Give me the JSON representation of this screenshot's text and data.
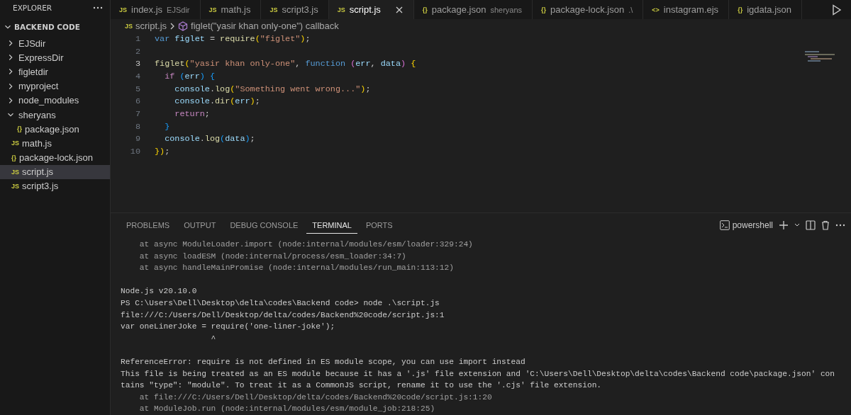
{
  "sidebar": {
    "title": "EXPLORER",
    "root": {
      "label": "BACKEND CODE",
      "expanded": true,
      "children": [
        {
          "kind": "folder",
          "label": "EJSdir",
          "expanded": false,
          "selected": false
        },
        {
          "kind": "folder",
          "label": "ExpressDir",
          "expanded": false,
          "selected": false
        },
        {
          "kind": "folder",
          "label": "figletdir",
          "expanded": false,
          "selected": false
        },
        {
          "kind": "folder",
          "label": "myproject",
          "expanded": false,
          "selected": false
        },
        {
          "kind": "folder",
          "label": "node_modules",
          "expanded": false,
          "selected": false
        },
        {
          "kind": "folder",
          "label": "sheryans",
          "expanded": true,
          "selected": false,
          "children": [
            {
              "kind": "file",
              "badge": "{}",
              "label": "package.json",
              "selected": false
            }
          ]
        },
        {
          "kind": "file",
          "badge": "JS",
          "label": "math.js",
          "selected": false
        },
        {
          "kind": "file",
          "badge": "{}",
          "label": "package-lock.json",
          "selected": false
        },
        {
          "kind": "file",
          "badge": "JS",
          "label": "script.js",
          "selected": true
        },
        {
          "kind": "file",
          "badge": "JS",
          "label": "script3.js",
          "selected": false
        }
      ]
    }
  },
  "tabs": [
    {
      "badge": "JS",
      "label": "index.js",
      "detail": "EJSdir",
      "selected": false
    },
    {
      "badge": "JS",
      "label": "math.js",
      "selected": false
    },
    {
      "badge": "JS",
      "label": "script3.js",
      "selected": false
    },
    {
      "badge": "JS",
      "label": "script.js",
      "selected": true
    },
    {
      "badge": "{}",
      "label": "package.json",
      "detail": "sheryans",
      "selected": false
    },
    {
      "badge": "{}",
      "label": "package-lock.json",
      "detail": ".\\",
      "selected": false
    },
    {
      "badge": "<>",
      "label": "instagram.ejs",
      "selected": false
    },
    {
      "badge": "{}",
      "label": "igdata.json",
      "selected": false
    }
  ],
  "breadcrumb": {
    "badge": "JS",
    "file": "script.js",
    "symbol": "figlet(\"yasir khan only-one\") callback"
  },
  "editor": {
    "lines": [
      {
        "number": "1",
        "tokens": [
          {
            "kind": "kw",
            "text": "var"
          },
          {
            "kind": "var",
            "text": " figlet"
          },
          {
            "kind": "plain",
            "text": " = "
          },
          {
            "kind": "fn",
            "text": "require"
          },
          {
            "kind": "b1",
            "text": "("
          },
          {
            "kind": "str",
            "text": "\"figlet\""
          },
          {
            "kind": "b1",
            "text": ")"
          },
          {
            "kind": "plain",
            "text": ";"
          }
        ]
      },
      {
        "number": "2"
      },
      {
        "number": "3",
        "tokens": [
          {
            "kind": "fn",
            "text": "figlet"
          },
          {
            "kind": "b1",
            "text": "("
          },
          {
            "kind": "str",
            "text": "\"yasir khan only-one\""
          },
          {
            "kind": "plain",
            "text": ", "
          },
          {
            "kind": "kw",
            "text": "function"
          },
          {
            "kind": "b2",
            "text": " ("
          },
          {
            "kind": "var",
            "text": "err"
          },
          {
            "kind": "plain",
            "text": ", "
          },
          {
            "kind": "var",
            "text": "data"
          },
          {
            "kind": "b2",
            "text": ")"
          },
          {
            "kind": "b1",
            "text": " {"
          }
        ]
      },
      {
        "number": "4",
        "tokens": [
          {
            "kind": "ctl",
            "text": "  if"
          },
          {
            "kind": "b3",
            "text": " ("
          },
          {
            "kind": "var",
            "text": "err"
          },
          {
            "kind": "b3",
            "text": ")"
          },
          {
            "kind": "b3",
            "text": " {"
          }
        ]
      },
      {
        "number": "5",
        "tokens": [
          {
            "kind": "var",
            "text": "    console"
          },
          {
            "kind": "plain",
            "text": "."
          },
          {
            "kind": "fn",
            "text": "log"
          },
          {
            "kind": "b1",
            "text": "("
          },
          {
            "kind": "str",
            "text": "\"Something went wrong...\""
          },
          {
            "kind": "b1",
            "text": ")"
          },
          {
            "kind": "plain",
            "text": ";"
          }
        ]
      },
      {
        "number": "6",
        "tokens": [
          {
            "kind": "var",
            "text": "    console"
          },
          {
            "kind": "plain",
            "text": "."
          },
          {
            "kind": "fn",
            "text": "dir"
          },
          {
            "kind": "b1",
            "text": "("
          },
          {
            "kind": "var",
            "text": "err"
          },
          {
            "kind": "b1",
            "text": ")"
          },
          {
            "kind": "plain",
            "text": ";"
          }
        ]
      },
      {
        "number": "7",
        "tokens": [
          {
            "kind": "ctl",
            "text": "    return"
          },
          {
            "kind": "plain",
            "text": ";"
          }
        ]
      },
      {
        "number": "8",
        "tokens": [
          {
            "kind": "b3",
            "text": "  }"
          }
        ]
      },
      {
        "number": "9",
        "tokens": [
          {
            "kind": "var",
            "text": "  console"
          },
          {
            "kind": "plain",
            "text": "."
          },
          {
            "kind": "fn",
            "text": "log"
          },
          {
            "kind": "b3",
            "text": "("
          },
          {
            "kind": "var",
            "text": "data"
          },
          {
            "kind": "b3",
            "text": ")"
          },
          {
            "kind": "plain",
            "text": ";"
          }
        ]
      },
      {
        "number": "10",
        "tokens": [
          {
            "kind": "b1",
            "text": "}"
          },
          {
            "kind": "b1",
            "text": ")"
          },
          {
            "kind": "plain",
            "text": ";"
          }
        ]
      }
    ]
  },
  "panel": {
    "tabs": [
      {
        "label": "PROBLEMS",
        "selected": false
      },
      {
        "label": "OUTPUT",
        "selected": false
      },
      {
        "label": "DEBUG CONSOLE",
        "selected": false
      },
      {
        "label": "TERMINAL",
        "selected": true
      },
      {
        "label": "PORTS",
        "selected": false
      }
    ],
    "shell": "powershell",
    "lines": [
      {
        "kind": "stack",
        "text": "    at async ModuleLoader.import (node:internal/modules/esm/loader:329:24)"
      },
      {
        "kind": "stack",
        "text": "    at async loadESM (node:internal/process/esm_loader:34:7)"
      },
      {
        "kind": "stack",
        "text": "    at async handleMainPromise (node:internal/modules/run_main:113:12)"
      },
      {
        "kind": "blank"
      },
      {
        "kind": "normal",
        "text": "Node.js v20.10.0"
      },
      {
        "kind": "normal",
        "text": "PS C:\\Users\\Dell\\Desktop\\delta\\codes\\Backend code> node .\\script.js"
      },
      {
        "kind": "normal",
        "text": "file:///C:/Users/Dell/Desktop/delta/codes/Backend%20code/script.js:1"
      },
      {
        "kind": "normal",
        "text": "var oneLinerJoke = require('one-liner-joke');"
      },
      {
        "kind": "normal",
        "text": "                   ^"
      },
      {
        "kind": "blank"
      },
      {
        "kind": "normal",
        "text": "ReferenceError: require is not defined in ES module scope, you can use import instead"
      },
      {
        "kind": "normal",
        "text": "This file is being treated as an ES module because it has a '.js' file extension and 'C:\\Users\\Dell\\Desktop\\delta\\codes\\Backend code\\package.json' con"
      },
      {
        "kind": "normal",
        "text": "tains \"type\": \"module\". To treat it as a CommonJS script, rename it to use the '.cjs' file extension."
      },
      {
        "kind": "stack",
        "text": "    at file:///C:/Users/Dell/Desktop/delta/codes/Backend%20code/script.js:1:20"
      },
      {
        "kind": "stack",
        "text": "    at ModuleJob.run (node:internal/modules/esm/module_job:218:25)"
      }
    ]
  }
}
